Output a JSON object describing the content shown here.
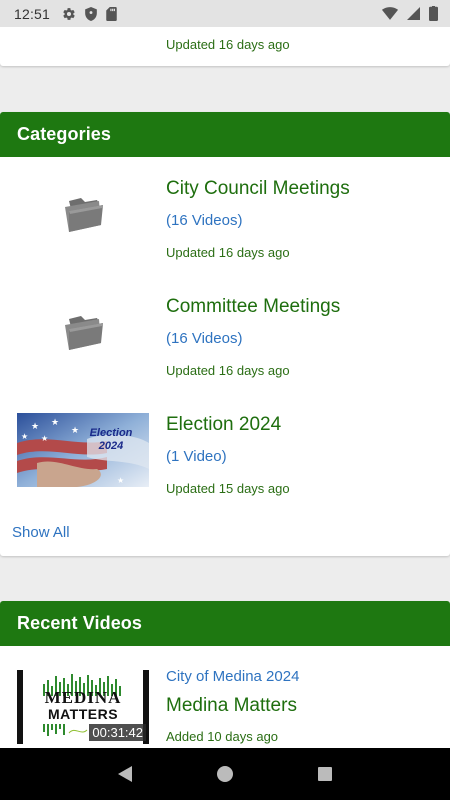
{
  "status_bar": {
    "time": "12:51"
  },
  "top_card": {
    "updated_text": "Updated 16 days ago"
  },
  "categories": {
    "header": "Categories",
    "items": [
      {
        "title": "City Council Meetings",
        "count": "(16 Videos)",
        "updated": "Updated 16 days ago",
        "thumb": "folder-icon"
      },
      {
        "title": "Committee Meetings",
        "count": "(16 Videos)",
        "updated": "Updated 16 days ago",
        "thumb": "folder-icon"
      },
      {
        "title": "Election 2024",
        "count": "(1 Video)",
        "updated": "Updated 15 days ago",
        "thumb": "election-thumbnail",
        "thumb_text": "Election 2024"
      }
    ],
    "show_all": "Show All"
  },
  "recent_videos": {
    "header": "Recent Videos",
    "items": [
      {
        "channel": "City of Medina 2024",
        "title": "Medina Matters",
        "added": "Added 10 days ago",
        "duration": "00:31:42",
        "thumb_text_1": "MEDINA",
        "thumb_text_2": "MATTERS"
      }
    ]
  },
  "colors": {
    "header_green": "#1e7811",
    "title_green": "#1e6e0e",
    "link_blue": "#2e73c0"
  }
}
